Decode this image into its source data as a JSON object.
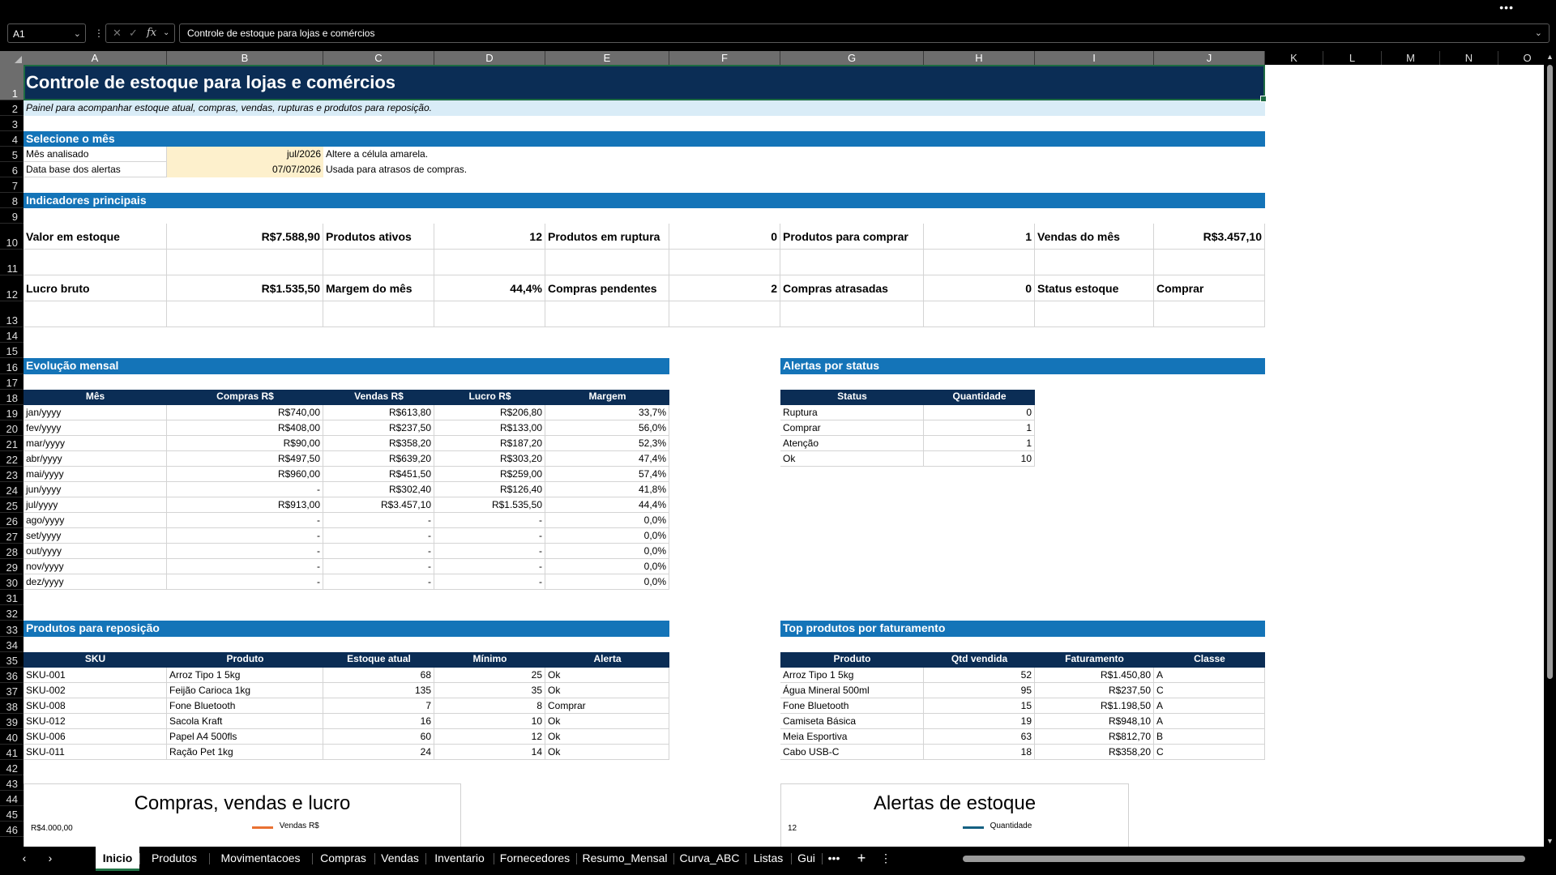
{
  "window": {
    "more_label": "•••"
  },
  "formula_bar": {
    "name_box": "A1",
    "content": "Controle de estoque para lojas e comércios",
    "fx_label": "fx"
  },
  "columns": [
    "A",
    "B",
    "C",
    "D",
    "E",
    "F",
    "G",
    "H",
    "I",
    "J",
    "K",
    "L",
    "M",
    "N",
    "O"
  ],
  "rows": [
    "1",
    "2",
    "3",
    "4",
    "5",
    "6",
    "7",
    "8",
    "9",
    "10",
    "11",
    "12",
    "13",
    "14",
    "15",
    "16",
    "17",
    "18",
    "19",
    "20",
    "21",
    "22",
    "23",
    "24",
    "25",
    "26",
    "27",
    "28",
    "29",
    "30",
    "31",
    "32",
    "33",
    "34",
    "35",
    "36",
    "37",
    "38",
    "39",
    "40",
    "41",
    "42",
    "43",
    "44",
    "45",
    "46"
  ],
  "sheet": {
    "title": "Controle de estoque para lojas e comércios",
    "subtitle": "Painel para acompanhar estoque atual, compras, vendas, rupturas e produtos para reposição.",
    "month_section": "Selecione o mês",
    "month_rows": [
      {
        "label": "Mês analisado",
        "value": "jul/2026",
        "note": "Altere a célula amarela."
      },
      {
        "label": "Data base dos alertas",
        "value": "07/07/2026",
        "note": "Usada para atrasos de compras."
      }
    ],
    "kpi_section": "Indicadores principais",
    "kpis_row1": [
      {
        "label": "Valor em estoque",
        "value": "R$7.588,90"
      },
      {
        "label": "Produtos ativos",
        "value": "12"
      },
      {
        "label": "Produtos em ruptura",
        "value": "0"
      },
      {
        "label": "Produtos para comprar",
        "value": "1"
      },
      {
        "label": "Vendas do mês",
        "value": "R$3.457,10"
      }
    ],
    "kpis_row2": [
      {
        "label": "Lucro bruto",
        "value": "R$1.535,50"
      },
      {
        "label": "Margem do mês",
        "value": "44,4%"
      },
      {
        "label": "Compras pendentes",
        "value": "2"
      },
      {
        "label": "Compras atrasadas",
        "value": "0"
      },
      {
        "label": "Status estoque",
        "value": "Comprar"
      }
    ],
    "monthly": {
      "section": "Evolução mensal",
      "headers": [
        "Mês",
        "Compras R$",
        "Vendas R$",
        "Lucro R$",
        "Margem"
      ],
      "rows": [
        [
          "jan/yyyy",
          "R$740,00",
          "R$613,80",
          "R$206,80",
          "33,7%"
        ],
        [
          "fev/yyyy",
          "R$408,00",
          "R$237,50",
          "R$133,00",
          "56,0%"
        ],
        [
          "mar/yyyy",
          "R$90,00",
          "R$358,20",
          "R$187,20",
          "52,3%"
        ],
        [
          "abr/yyyy",
          "R$497,50",
          "R$639,20",
          "R$303,20",
          "47,4%"
        ],
        [
          "mai/yyyy",
          "R$960,00",
          "R$451,50",
          "R$259,00",
          "57,4%"
        ],
        [
          "jun/yyyy",
          "-",
          "R$302,40",
          "R$126,40",
          "41,8%"
        ],
        [
          "jul/yyyy",
          "R$913,00",
          "R$3.457,10",
          "R$1.535,50",
          "44,4%"
        ],
        [
          "ago/yyyy",
          "-",
          "-",
          "-",
          "0,0%"
        ],
        [
          "set/yyyy",
          "-",
          "-",
          "-",
          "0,0%"
        ],
        [
          "out/yyyy",
          "-",
          "-",
          "-",
          "0,0%"
        ],
        [
          "nov/yyyy",
          "-",
          "-",
          "-",
          "0,0%"
        ],
        [
          "dez/yyyy",
          "-",
          "-",
          "-",
          "0,0%"
        ]
      ]
    },
    "alerts": {
      "section": "Alertas por status",
      "headers": [
        "Status",
        "Quantidade"
      ],
      "rows": [
        [
          "Ruptura",
          "0"
        ],
        [
          "Comprar",
          "1"
        ],
        [
          "Atenção",
          "1"
        ],
        [
          "Ok",
          "10"
        ]
      ]
    },
    "restock": {
      "section": "Produtos para reposição",
      "headers": [
        "SKU",
        "Produto",
        "Estoque atual",
        "Mínimo",
        "Alerta"
      ],
      "rows": [
        [
          "SKU-001",
          "Arroz Tipo 1 5kg",
          "68",
          "25",
          "Ok"
        ],
        [
          "SKU-002",
          "Feijão Carioca 1kg",
          "135",
          "35",
          "Ok"
        ],
        [
          "SKU-008",
          "Fone Bluetooth",
          "7",
          "8",
          "Comprar"
        ],
        [
          "SKU-012",
          "Sacola Kraft",
          "16",
          "10",
          "Ok"
        ],
        [
          "SKU-006",
          "Papel A4 500fls",
          "60",
          "12",
          "Ok"
        ],
        [
          "SKU-011",
          "Ração Pet 1kg",
          "24",
          "14",
          "Ok"
        ]
      ]
    },
    "top_products": {
      "section": "Top produtos por faturamento",
      "headers": [
        "Produto",
        "Qtd vendida",
        "Faturamento",
        "Classe"
      ],
      "rows": [
        [
          "Arroz Tipo 1 5kg",
          "52",
          "R$1.450,80",
          "A"
        ],
        [
          "Água Mineral 500ml",
          "95",
          "R$237,50",
          "C"
        ],
        [
          "Fone Bluetooth",
          "15",
          "R$1.198,50",
          "A"
        ],
        [
          "Camiseta Básica",
          "19",
          "R$948,10",
          "A"
        ],
        [
          "Meia Esportiva",
          "63",
          "R$812,70",
          "B"
        ],
        [
          "Cabo USB-C",
          "18",
          "R$358,20",
          "C"
        ]
      ]
    },
    "chart1": {
      "title": "Compras, vendas e lucro",
      "axis_label": "R$4.000,00",
      "legend": "Vendas R$"
    },
    "chart2": {
      "title": "Alertas de estoque",
      "axis_label": "12",
      "legend": "Quantidade"
    }
  },
  "tabs": [
    "Inicio",
    "Produtos",
    "Movimentacoes",
    "Compras",
    "Vendas",
    "Inventario",
    "Fornecedores",
    "Resumo_Mensal",
    "Curva_ABC",
    "Listas",
    "Gui"
  ],
  "tab_controls": {
    "more": "•••",
    "add": "+",
    "options": "⋮",
    "prev": "‹",
    "next": "›"
  },
  "colors": {
    "dark": "#0b2d55",
    "section": "#1474b8",
    "subtitle_bg": "#d9ecf7",
    "input_yellow": "#fdf0cc"
  }
}
